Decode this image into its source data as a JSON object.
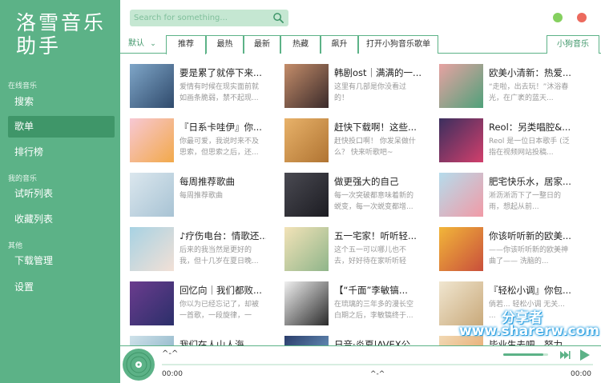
{
  "app": {
    "title": "洛雪音乐助手"
  },
  "sidebar": {
    "sections": [
      {
        "label": "在线音乐",
        "items": [
          {
            "label": "搜索"
          },
          {
            "label": "歌单",
            "active": true
          },
          {
            "label": "排行榜"
          }
        ]
      },
      {
        "label": "我的音乐",
        "items": [
          {
            "label": "试听列表"
          },
          {
            "label": "收藏列表"
          }
        ]
      },
      {
        "label": "其他",
        "items": [
          {
            "label": "下载管理"
          },
          {
            "label": "设置"
          }
        ]
      }
    ]
  },
  "search": {
    "placeholder": "Search for something..."
  },
  "window_controls": {
    "minimize_color": "#85d05f",
    "close_color": "#ec6a5e"
  },
  "tabs": {
    "default_label": "默认",
    "items": [
      "推荐",
      "最热",
      "最新",
      "热藏",
      "飙升",
      "打开小狗音乐歌单"
    ],
    "active_index": 0,
    "source_label": "小狗音乐"
  },
  "playlists": [
    {
      "title": "要是累了就停下来...",
      "desc": "爱情有时候在现实面前就如画条脆弱，禁不起现...",
      "colors": [
        "#7fa6c8",
        "#2f4a6c"
      ]
    },
    {
      "title": "韩剧ost｜满满的一...",
      "desc": "这里有几部是你没看过的！",
      "colors": [
        "#c48d6a",
        "#3a2a2a"
      ]
    },
    {
      "title": "欧美小清新：热爱...",
      "desc": "“走啦，出去玩！”沐浴春光，在广袤的蓝天...",
      "colors": [
        "#e7a2a2",
        "#4fa17a"
      ]
    },
    {
      "title": "『日系卡哇伊』你...",
      "desc": "你最可爱，我说时来不及思索，但思索之后，还...",
      "colors": [
        "#f7c8d4",
        "#f2a94a"
      ]
    },
    {
      "title": "赶快下载啊！这些...",
      "desc": "赶快投口啊！ 你发呆做什么？ 快来听歌吧~",
      "colors": [
        "#e8b26a",
        "#b07432"
      ]
    },
    {
      "title": "Reol：另类唱腔&...",
      "desc": "Reol 是一位日本歌手 (泛指在视频网站投稿...",
      "colors": [
        "#3b2f5e",
        "#d23f6c"
      ]
    },
    {
      "title": "每周推荐歌曲",
      "desc": "每周推荐歌曲",
      "colors": [
        "#dbe7ee",
        "#a8c3d4"
      ]
    },
    {
      "title": "做更强大的自己",
      "desc": "每一次突破都意味着新的蜕变，每一次蜕变都增...",
      "colors": [
        "#4a4a52",
        "#1c1c22"
      ]
    },
    {
      "title": "肥宅快乐水，居家...",
      "desc": "淅沥淅沥下了一整日的雨，想起从前...",
      "colors": [
        "#b5dcec",
        "#f19aa6"
      ]
    },
    {
      "title": "♪疗伤电台：情歌还...",
      "desc": "后来的我当然是更好的我，但十几岁在夏日晚...",
      "colors": [
        "#a7d2e3",
        "#f2e0d6"
      ]
    },
    {
      "title": "五一宅家！听听轻...",
      "desc": "这个五一可以哪儿也不去，好好待在家听听轻音...",
      "colors": [
        "#f3e3b8",
        "#8fb58a"
      ]
    },
    {
      "title": "你该听听新的欧美...",
      "desc": "——你该听听新的欧美神曲了—— 洗脑的...",
      "colors": [
        "#f2b63a",
        "#c94f3b"
      ]
    },
    {
      "title": "回忆向｜我们都败...",
      "desc": "你以为已经忘记了，却被一首歌，一段旋律，一张...",
      "colors": [
        "#6b3c8e",
        "#2b2f6a"
      ]
    },
    {
      "title": "【“千面”李敏镐...",
      "desc": "在琉璃的三年多的漫长空白期之后，李敏镐终于...",
      "colors": [
        "#f0f0f0",
        "#2a2a2a"
      ]
    },
    {
      "title": "『轻松小调』你包...",
      "desc": "倘若... 轻松小调 无关... ...",
      "colors": [
        "#f0e6d0",
        "#c9a97a"
      ]
    },
    {
      "title": "我们在人山人海...",
      "desc": "",
      "colors": [
        "#cfe2ea",
        "#7aa7be"
      ]
    },
    {
      "title": "日音·炎夏|AVEX公...",
      "desc": "",
      "colors": [
        "#2a3d6b",
        "#7fb2d8"
      ]
    },
    {
      "title": "毕业生去吧，努力...",
      "desc": "",
      "colors": [
        "#f1d9b4",
        "#e49b5a"
      ]
    }
  ],
  "player": {
    "track": "^-^",
    "time_current": "00:00",
    "time_marker": "^-^",
    "time_total": "00:00",
    "progress": 0,
    "volume": 0.9
  },
  "watermark": {
    "line1": "分享者",
    "line2": "www.sharerw.com"
  },
  "theme": {
    "accent": "#5cb287",
    "accent_dark": "#3f9669",
    "accent_light": "#c5e7d2"
  }
}
